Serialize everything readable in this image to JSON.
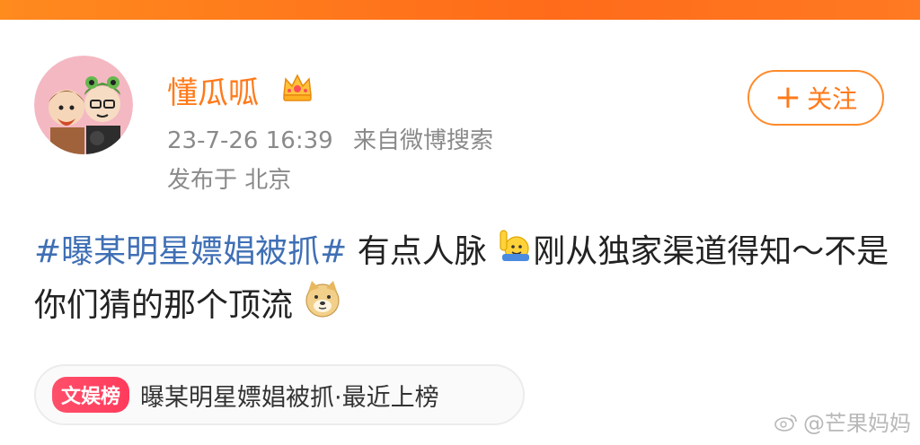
{
  "post": {
    "username": "懂瓜呱",
    "timestamp": "23-7-26 16:39",
    "source": "来自微博搜索",
    "location": "发布于 北京",
    "follow_label": "关注",
    "hashtag": "#曝某明星嫖娼被抓#",
    "text_part1": " 有点人脉",
    "text_part2": "刚从独家渠道得知～不是你们猜的那个顶流",
    "emoji1": "raising-hand-emoji",
    "emoji2": "doge-emoji"
  },
  "topic": {
    "badge": "文娱榜",
    "label": "曝某明星嫖娼被抓·最近上榜"
  },
  "watermark": "@芒果妈妈",
  "colors": {
    "accent": "#ff7a1a",
    "hashtag": "#3f6fb5",
    "meta": "#8a8a8a",
    "badge": "#ff3b5c"
  }
}
